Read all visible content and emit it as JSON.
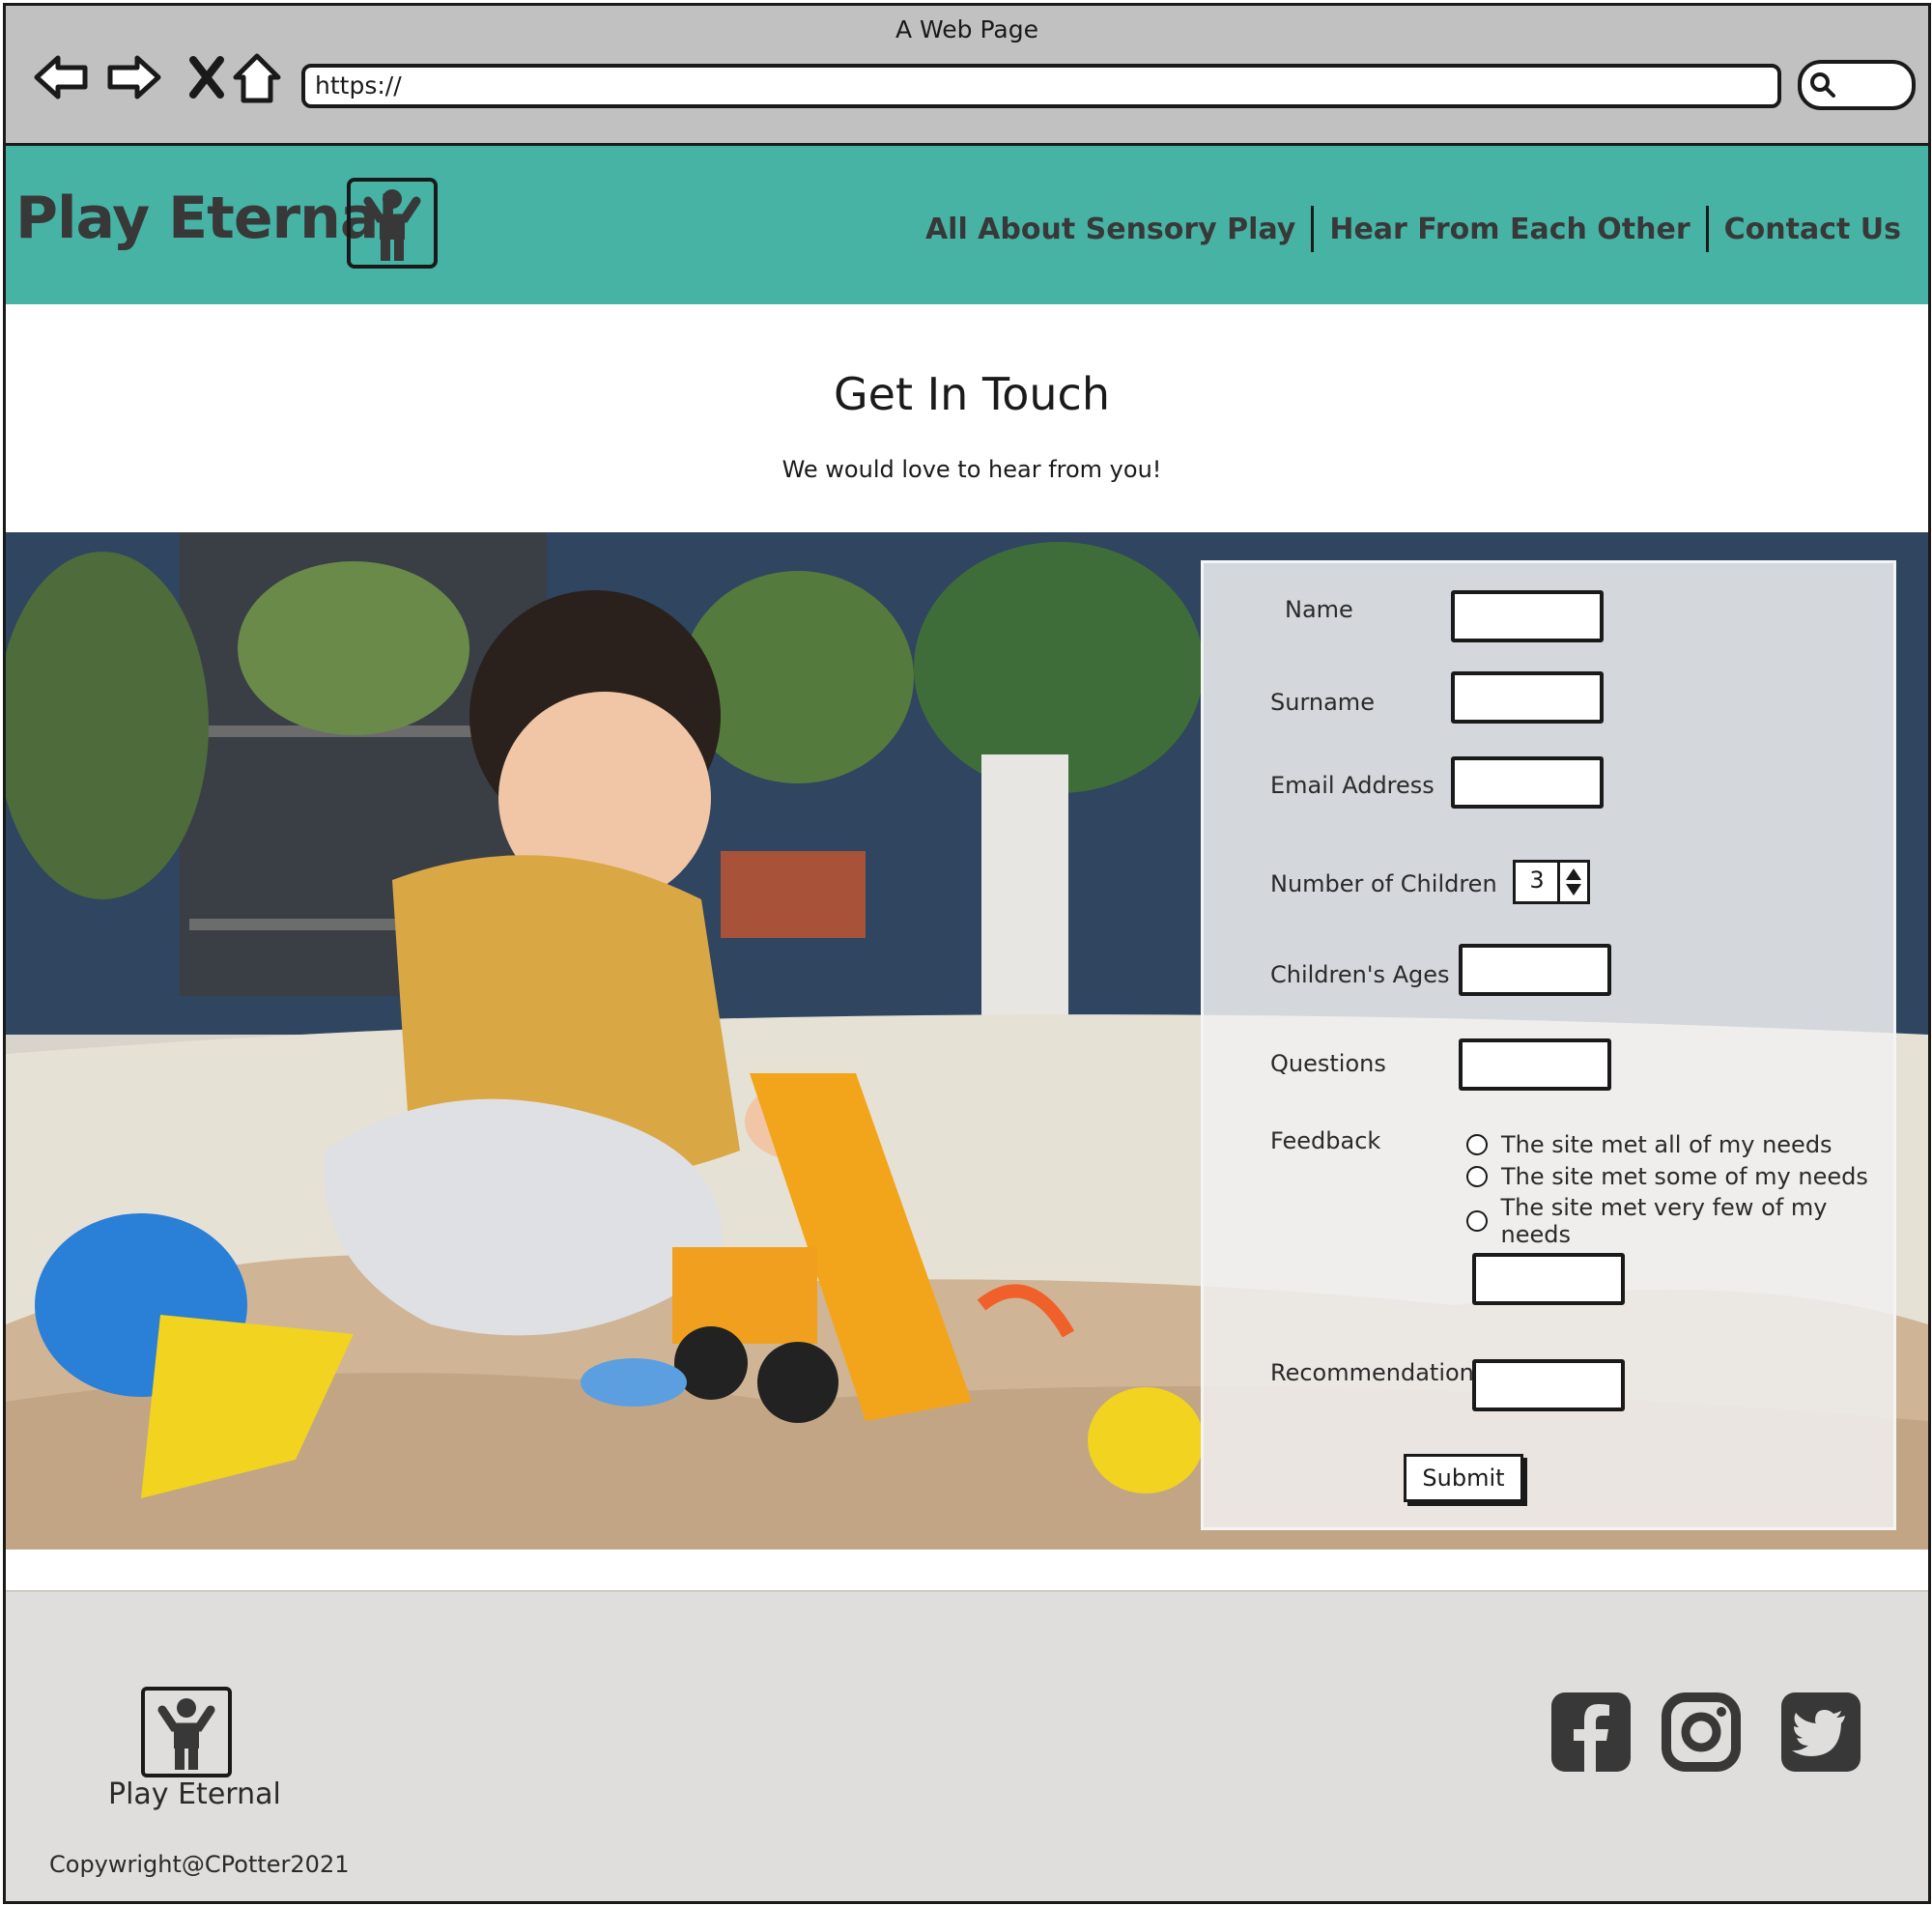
{
  "browser": {
    "window_title": "A Web Page",
    "url": "https://"
  },
  "header": {
    "brand": "Play Eternal",
    "nav": [
      {
        "label": "All About Sensory Play"
      },
      {
        "label": "Hear From Each Other"
      },
      {
        "label": "Contact Us"
      }
    ]
  },
  "intro": {
    "title": "Get In Touch",
    "subtitle": "We would love to hear from you!"
  },
  "form": {
    "name_label": "Name",
    "surname_label": "Surname",
    "email_label": "Email Address",
    "children_label": "Number of Children",
    "children_value": "3",
    "ages_label": "Children's Ages",
    "questions_label": "Questions",
    "feedback_label": "Feedback",
    "feedback_options": [
      "The site met all of my needs",
      "The site met some of my needs",
      "The site met very few of my needs"
    ],
    "recommendation_label": "Recommendation",
    "submit_label": "Submit"
  },
  "footer": {
    "brand": "Play Eternal",
    "copyright": "Copywright@CPotter2021",
    "social": [
      "facebook-icon",
      "instagram-icon",
      "twitter-icon"
    ]
  },
  "colors": {
    "header_bg": "#46b3a5",
    "chrome_bg": "#c1c1c1",
    "footer_bg": "#e0dedc"
  }
}
